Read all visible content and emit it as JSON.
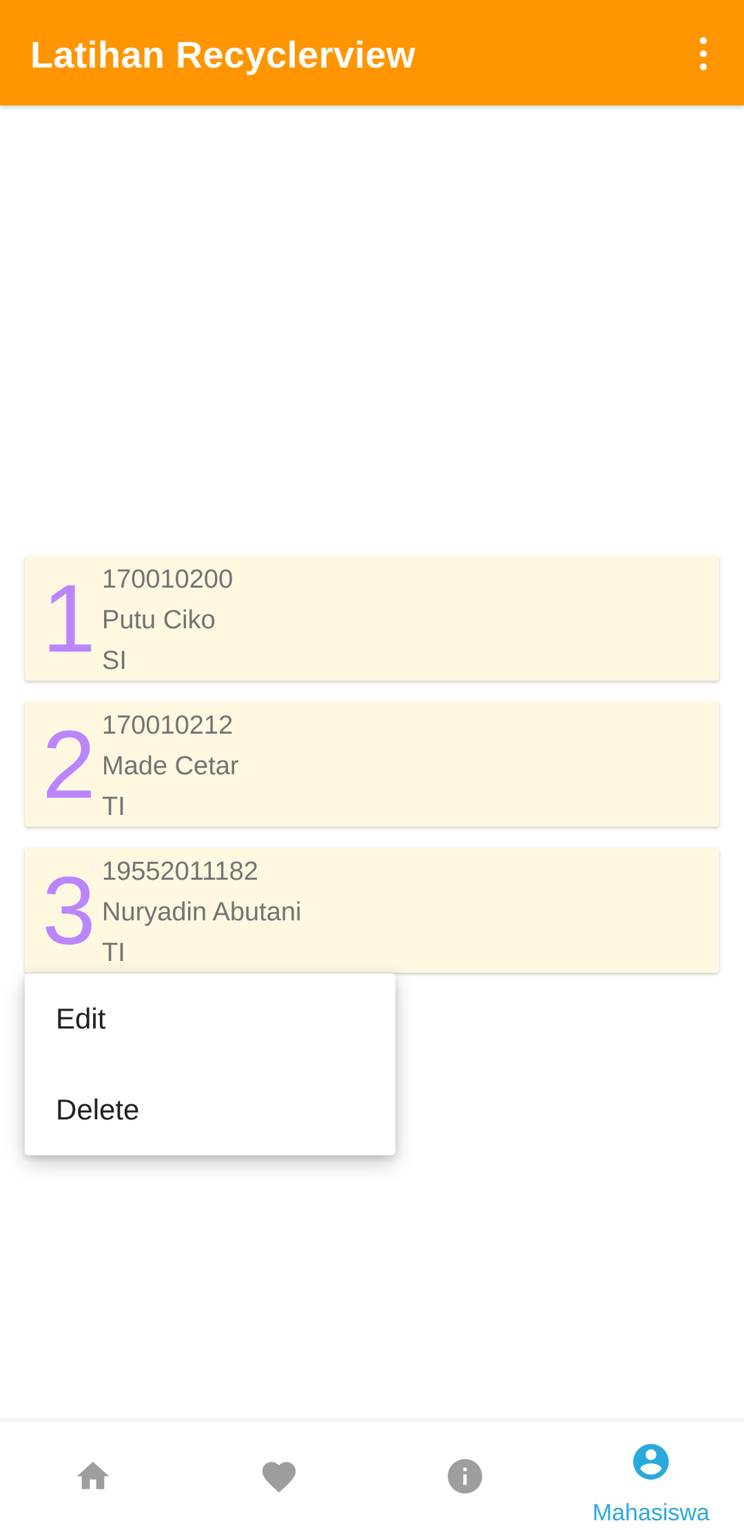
{
  "app_bar": {
    "title": "Latihan Recyclerview",
    "overflow_icon": "more-vert-icon"
  },
  "students": [
    {
      "number": "1",
      "nim": "170010200",
      "name": "Putu Ciko",
      "prodi": "SI"
    },
    {
      "number": "2",
      "nim": "170010212",
      "name": "Made Cetar",
      "prodi": "TI"
    },
    {
      "number": "3",
      "nim": "19552011182",
      "name": "Nuryadin Abutani",
      "prodi": "TI"
    }
  ],
  "context_menu": {
    "items": [
      "Edit",
      "Delete"
    ]
  },
  "bottom_nav": {
    "items": [
      {
        "icon": "home-icon",
        "label": ""
      },
      {
        "icon": "heart-icon",
        "label": ""
      },
      {
        "icon": "info-icon",
        "label": ""
      },
      {
        "icon": "account-circle-icon",
        "label": "Mahasiswa",
        "selected": true
      }
    ]
  },
  "colors": {
    "primary": "#FF9500",
    "card_background": "#FFF8E1",
    "number_accent": "#BB86FC",
    "nav_selected": "#29A9DC",
    "nav_inactive": "#9E9E9E"
  }
}
